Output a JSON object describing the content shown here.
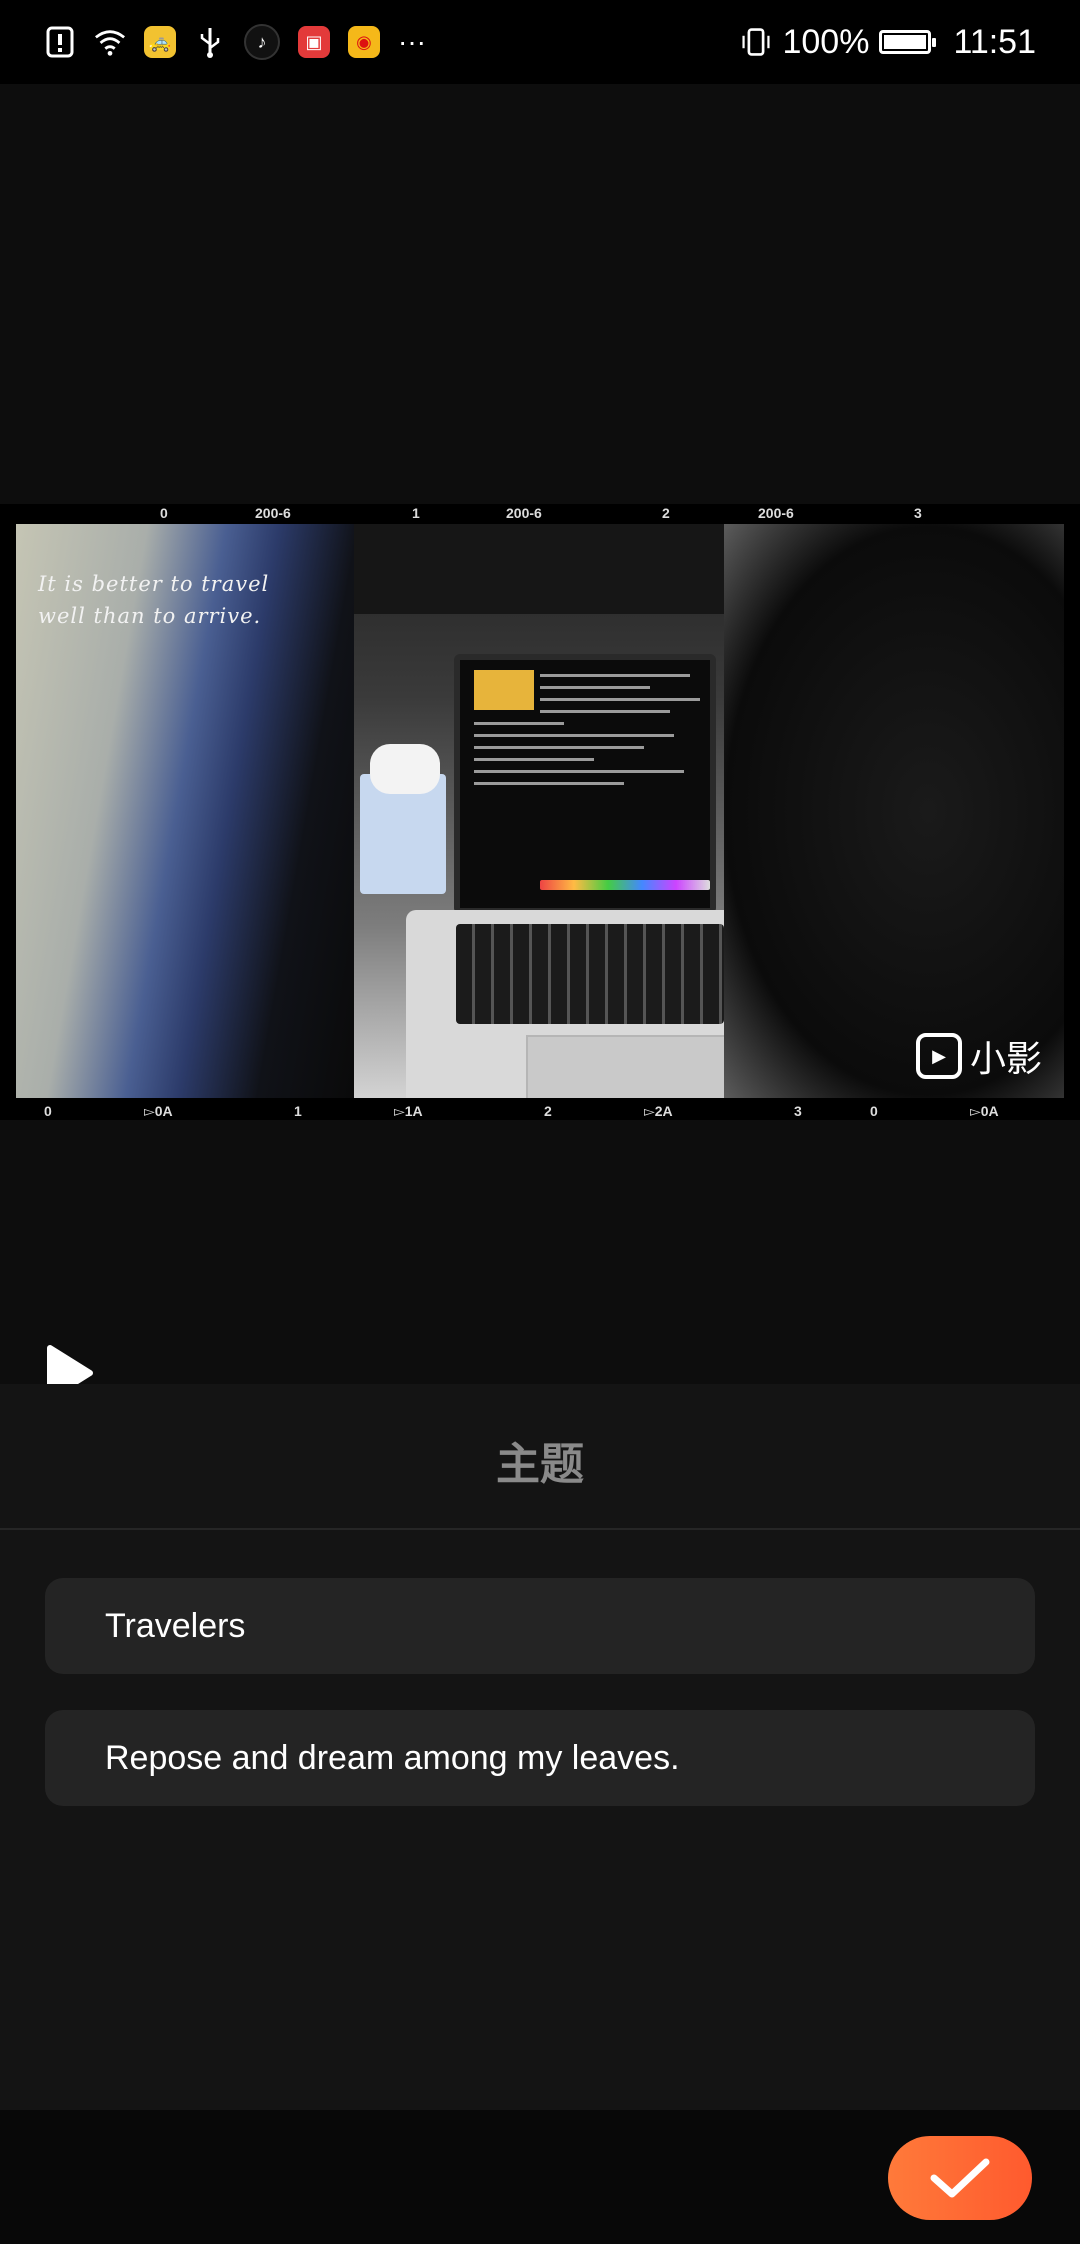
{
  "status_bar": {
    "battery_text": "100%",
    "battery_level": 1.0,
    "time": "11:51",
    "more_indicator": "···",
    "icons": [
      "alert-icon",
      "wifi-icon",
      "taxi-app-icon",
      "usb-icon",
      "tiktok-icon",
      "shop-app-icon",
      "weibo-icon",
      "vibrate-icon",
      "battery-icon"
    ]
  },
  "preview": {
    "film_top_labels": [
      "0",
      "200-6",
      "1",
      "200-6",
      "2",
      "200-6",
      "3"
    ],
    "film_bottom_labels": [
      "0",
      "▻0A",
      "1",
      "▻1A",
      "2",
      "▻2A",
      "3",
      "0",
      "▻0A"
    ],
    "quote": "It is better to travel\nwell than to arrive.",
    "watermark": "小影"
  },
  "panel": {
    "title": "主题",
    "fields": [
      {
        "value": "Travelers"
      },
      {
        "value": "Repose and dream among my leaves."
      }
    ]
  },
  "colors": {
    "accent": "#ff6a34",
    "background": "#0b0b0b",
    "panel": "#141414",
    "field": "#242424"
  }
}
